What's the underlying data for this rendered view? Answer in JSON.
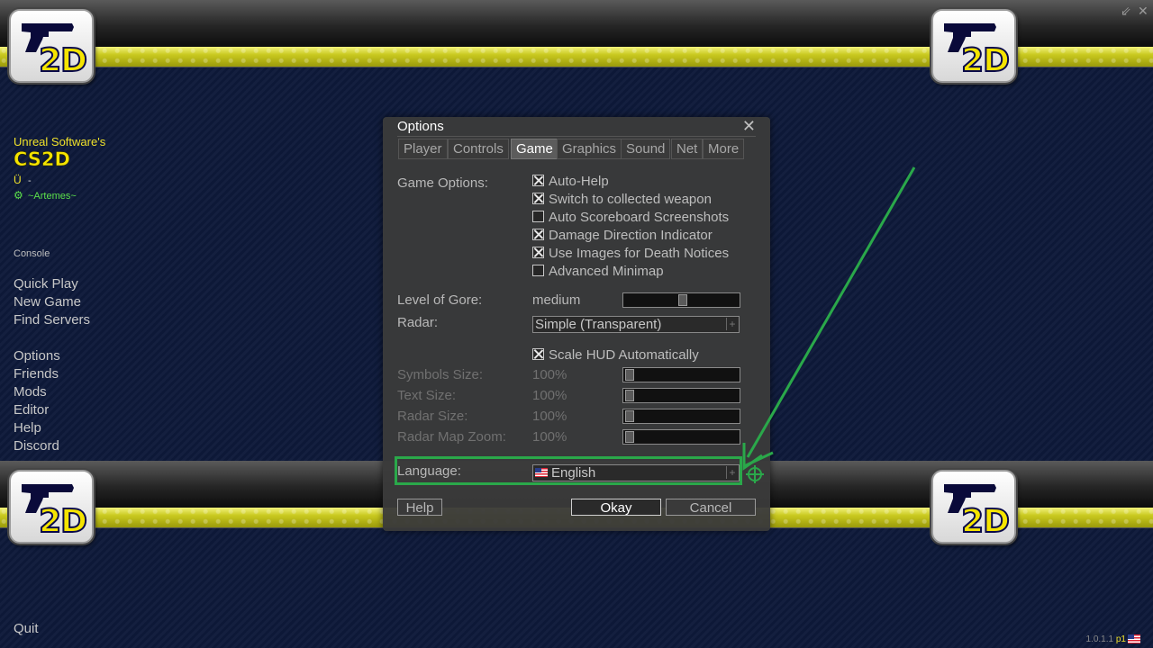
{
  "window": {
    "minimize_glyph": "⇙",
    "close_glyph": "✕"
  },
  "logo": {
    "text": "2D"
  },
  "sidebar": {
    "brand_line": "Unreal Software's",
    "brand_title": "CS2D",
    "usgn_value": "-",
    "steam_user": "~Artemes~",
    "console": "Console",
    "items": [
      {
        "label": "Quick Play"
      },
      {
        "label": "New Game"
      },
      {
        "label": "Find Servers"
      },
      {
        "label": "Options"
      },
      {
        "label": "Friends"
      },
      {
        "label": "Mods"
      },
      {
        "label": "Editor"
      },
      {
        "label": "Help"
      },
      {
        "label": "Discord"
      }
    ],
    "quit": "Quit"
  },
  "dialog": {
    "title": "Options",
    "close_glyph": "✕",
    "tabs": [
      {
        "label": "Player"
      },
      {
        "label": "Controls"
      },
      {
        "label": "Game",
        "active": true
      },
      {
        "label": "Graphics"
      },
      {
        "label": "Sound"
      },
      {
        "label": "Net"
      },
      {
        "label": "More"
      }
    ],
    "game_options_label": "Game Options:",
    "checkboxes": [
      {
        "label": "Auto-Help",
        "checked": true
      },
      {
        "label": "Switch to collected weapon",
        "checked": true
      },
      {
        "label": "Auto Scoreboard Screenshots",
        "checked": false
      },
      {
        "label": "Damage Direction Indicator",
        "checked": true
      },
      {
        "label": "Use Images for Death Notices",
        "checked": true
      },
      {
        "label": "Advanced Minimap",
        "checked": false
      }
    ],
    "gore": {
      "label": "Level of Gore:",
      "value": "medium",
      "level": 0.5
    },
    "radar": {
      "label": "Radar:",
      "value": "Simple (Transparent)",
      "plus": "+"
    },
    "scale_hud": {
      "label": "Scale HUD Automatically",
      "checked": true
    },
    "hud_sliders": [
      {
        "label": "Symbols Size:",
        "value": "100%",
        "level": 0
      },
      {
        "label": "Text Size:",
        "value": "100%",
        "level": 0
      },
      {
        "label": "Radar Size:",
        "value": "100%",
        "level": 0
      },
      {
        "label": "Radar Map Zoom:",
        "value": "100%",
        "level": 0
      }
    ],
    "language": {
      "label": "Language:",
      "value": "English",
      "plus": "+"
    },
    "buttons": {
      "help": "Help",
      "okay": "Okay",
      "cancel": "Cancel"
    }
  },
  "footer": {
    "version": "1.0.1.1",
    "build_tag": "p1"
  },
  "colors": {
    "highlight": "#2aa84a",
    "brand_yellow": "#f5e400",
    "steam_green": "#5be04a"
  }
}
